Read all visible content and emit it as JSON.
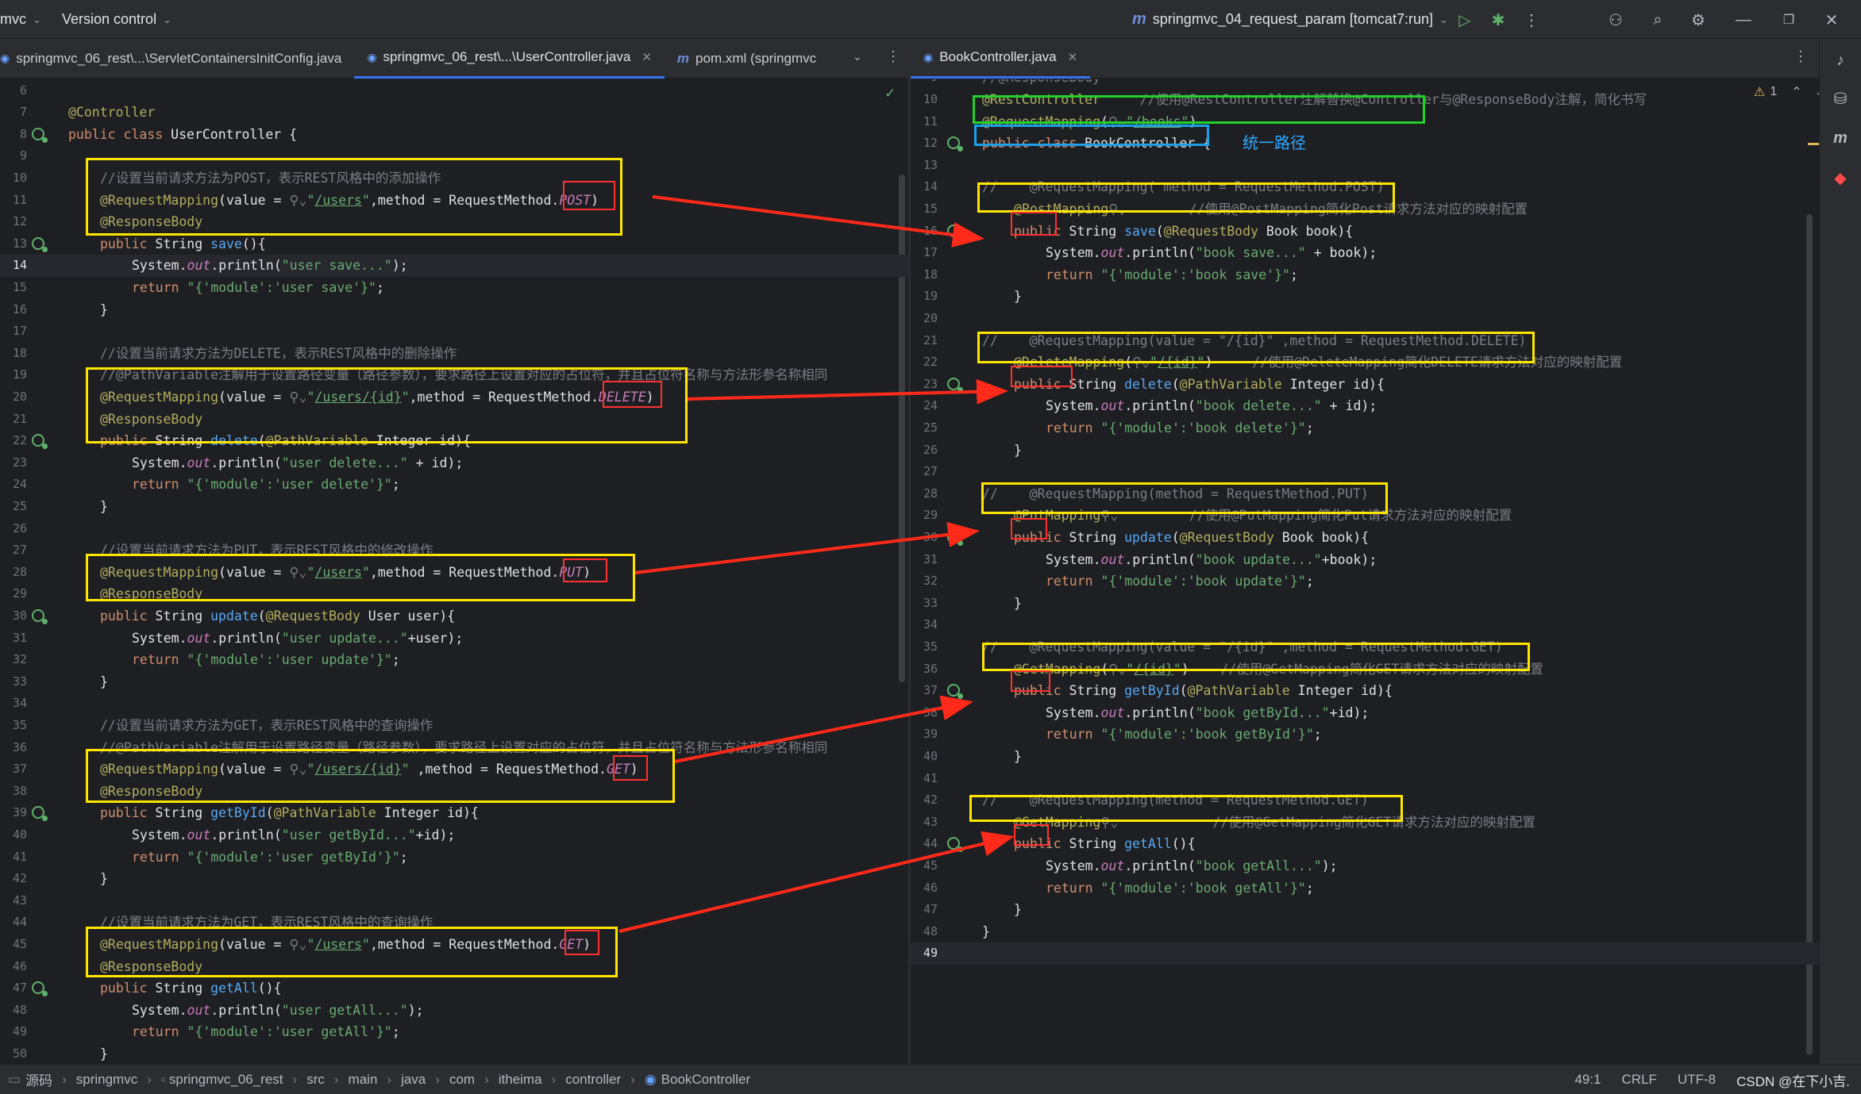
{
  "topbar": {
    "project_menu": "mvc",
    "vcs_menu": "Version control",
    "run_config_icon": "m",
    "run_config": "springmvc_04_request_param [tomcat7:run]"
  },
  "left_tabs": [
    {
      "label": "springmvc_06_rest\\...\\ServletContainersInitConfig.java",
      "icon": "c-icon"
    },
    {
      "label": "springmvc_06_rest\\...\\UserController.java",
      "icon": "c-icon",
      "close": "✕"
    },
    {
      "label": "pom.xml (springmvc",
      "icon": "m-icon"
    }
  ],
  "right_tabs": [
    {
      "label": "BookController.java",
      "icon": "c-icon",
      "close": "✕"
    }
  ],
  "editor_right": {
    "warning_count": "1",
    "note": "统一路径"
  },
  "statusbar": {
    "breadcrumbs": [
      "源码",
      "springmvc",
      "springmvc_06_rest",
      "src",
      "main",
      "java",
      "com",
      "itheima",
      "controller",
      "BookController"
    ],
    "position": "49:1",
    "line_ending": "CRLF",
    "encoding": "UTF-8",
    "watermark": "CSDN @在下小吉."
  }
}
